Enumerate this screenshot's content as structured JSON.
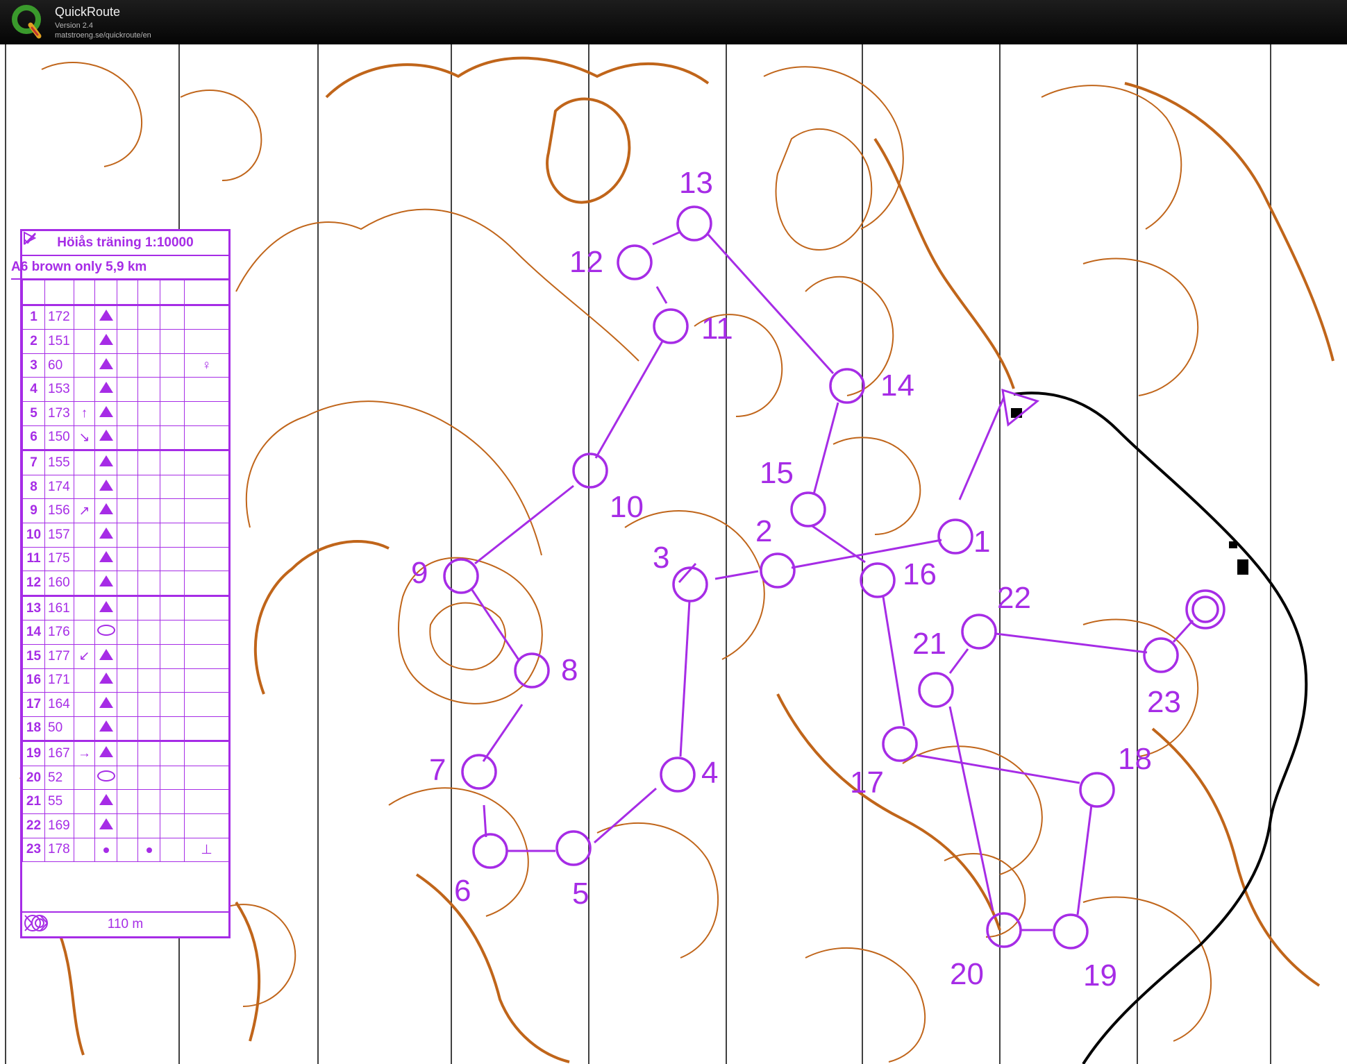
{
  "app": {
    "title": "QuickRoute",
    "version": "Version 2.4",
    "url": "matstroeng.se/quickroute/en"
  },
  "course_card": {
    "title": "Höiås träning 1:10000",
    "course": "A6 brown only  5,9 km",
    "finish_distance": "110 m",
    "controls": [
      {
        "num": "1",
        "code": "172",
        "dir": "",
        "feature": "tri",
        "extra": ""
      },
      {
        "num": "2",
        "code": "151",
        "dir": "",
        "feature": "tri",
        "extra": ""
      },
      {
        "num": "3",
        "code": "60",
        "dir": "",
        "feature": "tri",
        "extra": "♀"
      },
      {
        "num": "4",
        "code": "153",
        "dir": "",
        "feature": "tri",
        "extra": ""
      },
      {
        "num": "5",
        "code": "173",
        "dir": "↑",
        "feature": "tri",
        "extra": ""
      },
      {
        "num": "6",
        "code": "150",
        "dir": "↘",
        "feature": "tri",
        "extra": ""
      },
      {
        "num": "7",
        "code": "155",
        "dir": "",
        "feature": "tri",
        "extra": ""
      },
      {
        "num": "8",
        "code": "174",
        "dir": "",
        "feature": "tri",
        "extra": ""
      },
      {
        "num": "9",
        "code": "156",
        "dir": "↗",
        "feature": "tri",
        "extra": ""
      },
      {
        "num": "10",
        "code": "157",
        "dir": "",
        "feature": "tri",
        "extra": ""
      },
      {
        "num": "11",
        "code": "175",
        "dir": "",
        "feature": "tri",
        "extra": ""
      },
      {
        "num": "12",
        "code": "160",
        "dir": "",
        "feature": "tri",
        "extra": ""
      },
      {
        "num": "13",
        "code": "161",
        "dir": "",
        "feature": "tri",
        "extra": ""
      },
      {
        "num": "14",
        "code": "176",
        "dir": "",
        "feature": "ellipse",
        "extra": ""
      },
      {
        "num": "15",
        "code": "177",
        "dir": "↙",
        "feature": "tri",
        "extra": ""
      },
      {
        "num": "16",
        "code": "171",
        "dir": "",
        "feature": "tri",
        "extra": ""
      },
      {
        "num": "17",
        "code": "164",
        "dir": "",
        "feature": "tri",
        "extra": ""
      },
      {
        "num": "18",
        "code": "50",
        "dir": "",
        "feature": "tri",
        "extra": ""
      },
      {
        "num": "19",
        "code": "167",
        "dir": "→",
        "feature": "tri",
        "extra": ""
      },
      {
        "num": "20",
        "code": "52",
        "dir": "",
        "feature": "ellipse",
        "extra": ""
      },
      {
        "num": "21",
        "code": "55",
        "dir": "",
        "feature": "tri",
        "extra": ""
      },
      {
        "num": "22",
        "code": "169",
        "dir": "",
        "feature": "tri",
        "extra": ""
      },
      {
        "num": "23",
        "code": "178",
        "dir": "",
        "feature": "dots",
        "extra": "⊥"
      }
    ]
  },
  "map_controls": [
    {
      "label": "1"
    },
    {
      "label": "2"
    },
    {
      "label": "3"
    },
    {
      "label": "4"
    },
    {
      "label": "5"
    },
    {
      "label": "6"
    },
    {
      "label": "7"
    },
    {
      "label": "8"
    },
    {
      "label": "9"
    },
    {
      "label": "10"
    },
    {
      "label": "11"
    },
    {
      "label": "12"
    },
    {
      "label": "13"
    },
    {
      "label": "14"
    },
    {
      "label": "15"
    },
    {
      "label": "16"
    },
    {
      "label": "17"
    },
    {
      "label": "18"
    },
    {
      "label": "19"
    },
    {
      "label": "20"
    },
    {
      "label": "21"
    },
    {
      "label": "22"
    },
    {
      "label": "23"
    }
  ],
  "colors": {
    "course": "#a62ce6",
    "contour": "#c0651a",
    "header_bg": "#111111"
  }
}
